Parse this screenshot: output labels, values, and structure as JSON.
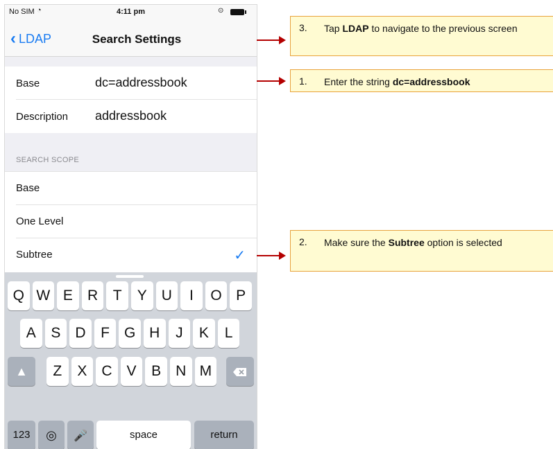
{
  "status_bar": {
    "carrier": "No SIM",
    "time": "4:11 pm"
  },
  "navbar": {
    "back_label": "LDAP",
    "title": "Search Settings"
  },
  "fields": [
    {
      "label": "Base",
      "value": "dc=addressbook"
    },
    {
      "label": "Description",
      "value": "addressbook"
    }
  ],
  "search_scope": {
    "header": "SEARCH SCOPE",
    "options": [
      {
        "label": "Base",
        "selected": false
      },
      {
        "label": "One Level",
        "selected": false
      },
      {
        "label": "Subtree",
        "selected": true
      }
    ]
  },
  "keyboard": {
    "row1": [
      "Q",
      "W",
      "E",
      "R",
      "T",
      "Y",
      "U",
      "I",
      "O",
      "P"
    ],
    "row2": [
      "A",
      "S",
      "D",
      "F",
      "G",
      "H",
      "J",
      "K",
      "L"
    ],
    "row3": [
      "Z",
      "X",
      "C",
      "V",
      "B",
      "N",
      "M"
    ],
    "numbers_label": "123",
    "space_label": "space",
    "return_label": "return"
  },
  "callouts": {
    "c1": {
      "num": "1.",
      "pre": "Enter the string ",
      "bold": "dc=addressbook",
      "post": ""
    },
    "c2": {
      "num": "2.",
      "pre": "Make sure the ",
      "bold": "Subtree",
      "post": " option is selected"
    },
    "c3": {
      "num": "3.",
      "pre": "Tap ",
      "bold": "LDAP",
      "post": " to navigate to the previous screen"
    }
  },
  "colors": {
    "accent": "#1a7cf2",
    "callout_bg": "#fffbd2",
    "callout_border": "#e8a23b",
    "arrow": "#b40000"
  }
}
